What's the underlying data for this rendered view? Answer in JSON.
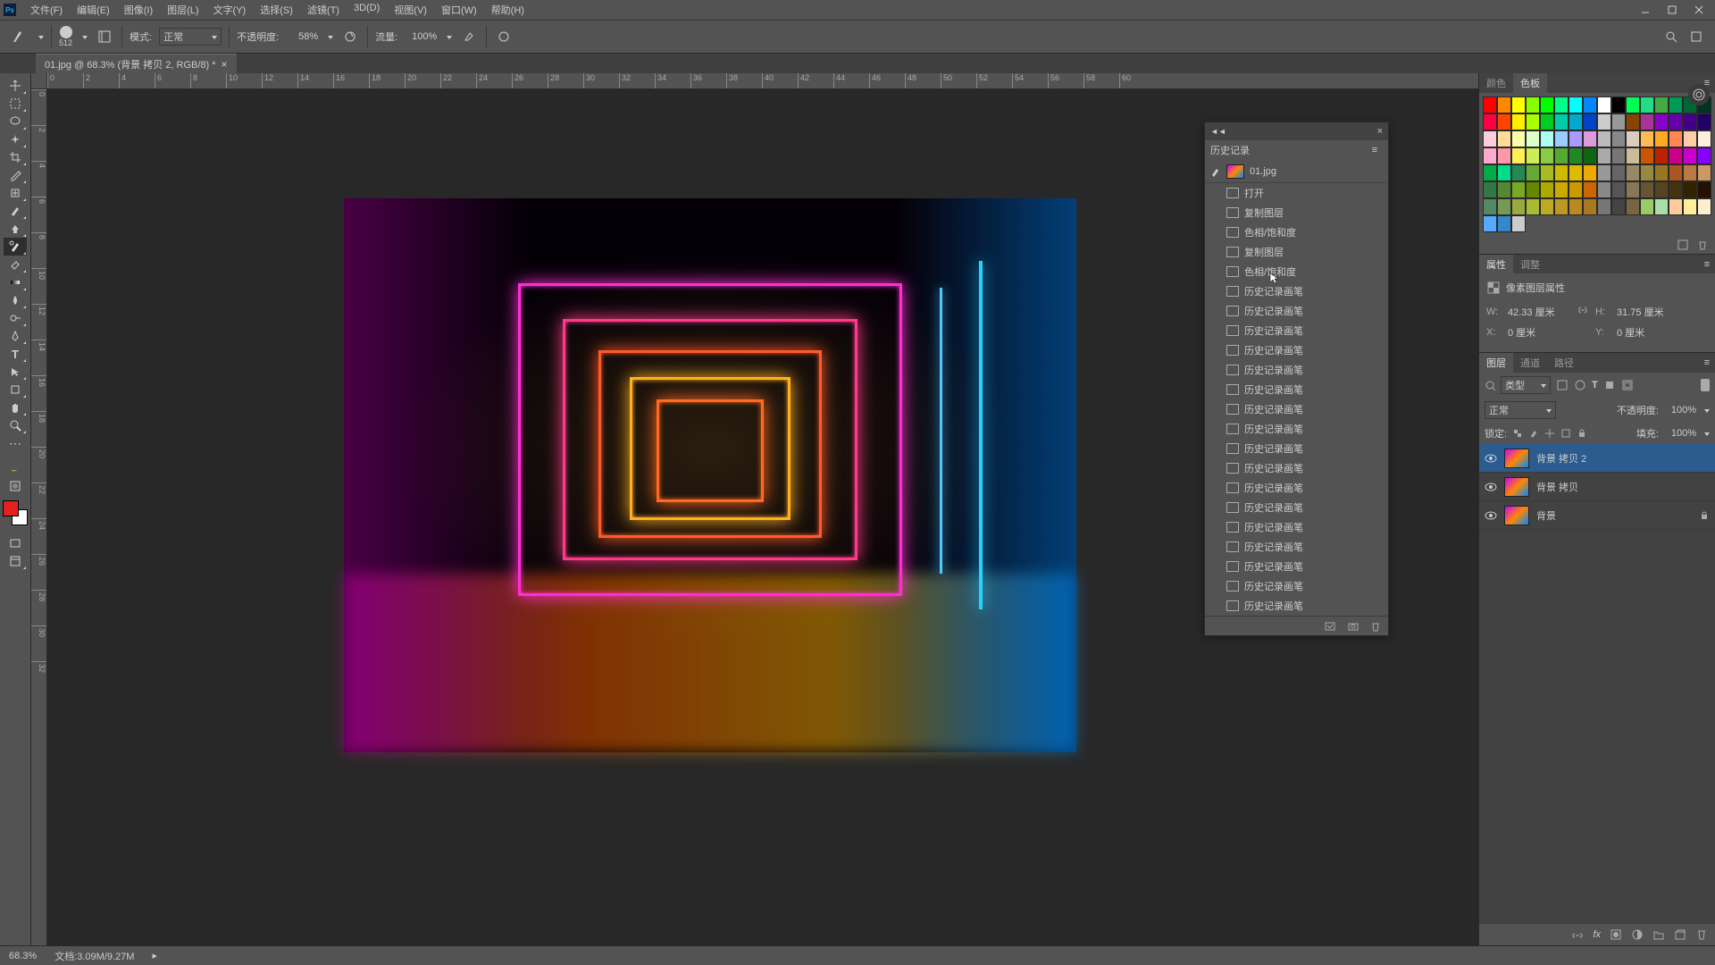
{
  "menubar": [
    "文件(F)",
    "编辑(E)",
    "图像(I)",
    "图层(L)",
    "文字(Y)",
    "选择(S)",
    "滤镜(T)",
    "3D(D)",
    "视图(V)",
    "窗口(W)",
    "帮助(H)"
  ],
  "optbar": {
    "brush_size": "512",
    "mode_label": "模式:",
    "mode_value": "正常",
    "opacity_label": "不透明度:",
    "opacity_value": "58%",
    "flow_label": "流量:",
    "flow_value": "100%"
  },
  "doc_tab": {
    "title": "01.jpg @ 68.3% (背景 拷贝 2, RGB/8) *"
  },
  "ruler_h": [
    "0",
    "2",
    "4",
    "6",
    "8",
    "10",
    "12",
    "14",
    "16",
    "18",
    "20",
    "22",
    "24",
    "26",
    "28",
    "30",
    "32",
    "34",
    "36",
    "38",
    "40",
    "42",
    "44",
    "46",
    "48",
    "50",
    "52",
    "54",
    "56",
    "58",
    "60"
  ],
  "ruler_v": [
    "0",
    "2",
    "4",
    "6",
    "8",
    "10",
    "12",
    "14",
    "16",
    "18",
    "20",
    "22",
    "24",
    "26",
    "28",
    "30",
    "32"
  ],
  "history": {
    "title": "历史记录",
    "snapshot": "01.jpg",
    "items": [
      "打开",
      "复制图层",
      "色相/饱和度",
      "复制图层",
      "色相/饱和度",
      "历史记录画笔",
      "历史记录画笔",
      "历史记录画笔",
      "历史记录画笔",
      "历史记录画笔",
      "历史记录画笔",
      "历史记录画笔",
      "历史记录画笔",
      "历史记录画笔",
      "历史记录画笔",
      "历史记录画笔",
      "历史记录画笔",
      "历史记录画笔",
      "历史记录画笔",
      "历史记录画笔",
      "历史记录画笔",
      "历史记录画笔"
    ]
  },
  "color_panel": {
    "tabs": [
      "颜色",
      "色板"
    ]
  },
  "swatches": [
    "#ff0000",
    "#ff8800",
    "#ffff00",
    "#88ff00",
    "#00ff00",
    "#00ff88",
    "#00ffff",
    "#0088ff",
    "#ffffff",
    "#000000",
    "#00ff55",
    "#22dd88",
    "#44aa44",
    "#009955",
    "#006633",
    "#003322",
    "#ff0044",
    "#ff4400",
    "#ffee00",
    "#aaff00",
    "#00cc22",
    "#00ccaa",
    "#00aacc",
    "#0044cc",
    "#cccccc",
    "#999999",
    "#884400",
    "#aa3399",
    "#8800cc",
    "#6600aa",
    "#440088",
    "#220066",
    "#ffccdd",
    "#ffdd99",
    "#ffffaa",
    "#ddffcc",
    "#aaffee",
    "#99ccff",
    "#aa99ff",
    "#dd99dd",
    "#bbbbbb",
    "#888888",
    "#ddccbb",
    "#ffbb55",
    "#ffaa22",
    "#ff8855",
    "#ffccaa",
    "#ffeedd",
    "#ffaacc",
    "#ff99aa",
    "#ffee55",
    "#ccee55",
    "#88cc44",
    "#55aa33",
    "#228822",
    "#116611",
    "#aaaaaa",
    "#777777",
    "#ccbb99",
    "#cc5500",
    "#bb2200",
    "#cc0088",
    "#cc00cc",
    "#8800ff",
    "#00aa44",
    "#00dd88",
    "#228855",
    "#66aa33",
    "#aabb22",
    "#ccbb00",
    "#ddbb00",
    "#eeaa00",
    "#999999",
    "#666666",
    "#998866",
    "#998844",
    "#997722",
    "#aa5522",
    "#bb7744",
    "#cc9966",
    "#337744",
    "#558833",
    "#77aa22",
    "#668800",
    "#aaaa00",
    "#ccaa00",
    "#cc9900",
    "#cc6600",
    "#888888",
    "#555555",
    "#887755",
    "#665533",
    "#554422",
    "#443311",
    "#332200",
    "#221100",
    "#558866",
    "#779955",
    "#99aa44",
    "#aabb33",
    "#bbaa22",
    "#bb9922",
    "#bb8822",
    "#aa7722",
    "#777777",
    "#444444",
    "#776644",
    "#99cc66",
    "#aaddaa",
    "#ffcc99",
    "#ffee99",
    "#ffeecc",
    "#55aaff",
    "#3388cc",
    "#cccccc"
  ],
  "props": {
    "tabs": [
      "属性",
      "调整"
    ],
    "title": "像素图层属性",
    "w_label": "W:",
    "w_value": "42.33 厘米",
    "h_label": "H:",
    "h_value": "31.75 厘米",
    "x_label": "X:",
    "x_value": "0 厘米",
    "y_label": "Y:",
    "y_value": "0 厘米"
  },
  "layers": {
    "tabs": [
      "图层",
      "通道",
      "路径"
    ],
    "kind_label": "类型",
    "blend_mode": "正常",
    "opacity_label": "不透明度:",
    "opacity_value": "100%",
    "lock_label": "锁定:",
    "fill_label": "填充:",
    "fill_value": "100%",
    "items": [
      {
        "name": "背景 拷贝 2",
        "selected": true,
        "locked": false
      },
      {
        "name": "背景 拷贝",
        "selected": false,
        "locked": false
      },
      {
        "name": "背景",
        "selected": false,
        "locked": true
      }
    ]
  },
  "statusbar": {
    "zoom": "68.3%",
    "doc_info": "文档:3.09M/9.27M"
  }
}
